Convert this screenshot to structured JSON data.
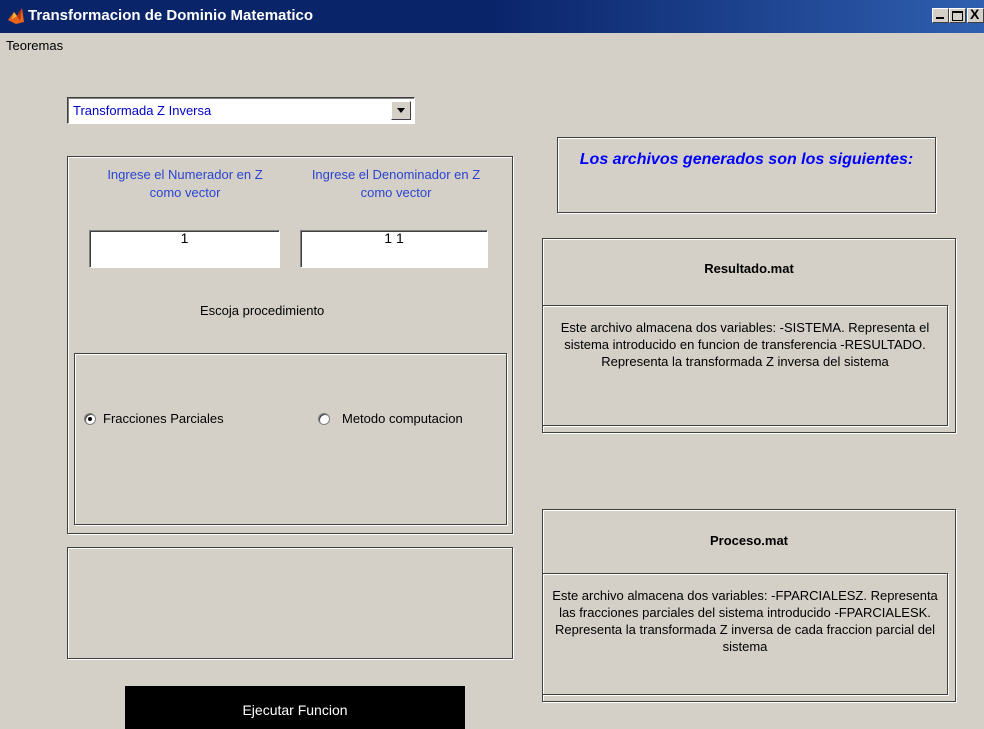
{
  "window": {
    "title": "Transformacion de Dominio Matematico",
    "close_glyph": "X"
  },
  "menu": {
    "items": [
      "Teoremas"
    ]
  },
  "transform_select": {
    "selected": "Transformada Z Inversa"
  },
  "inputs": {
    "numerator_label": "Ingrese el Numerador en Z como vector",
    "denominator_label": "Ingrese el Denominador en Z como vector",
    "numerator_value": "1",
    "denominator_value": "1 1"
  },
  "procedure": {
    "label": "Escoja procedimiento",
    "options": [
      "Fracciones Parciales",
      "Metodo computacion"
    ],
    "selected_index": 0
  },
  "actions": {
    "run_label": "Ejecutar Funcion"
  },
  "files": {
    "header": "Los archivos generados son los siguientes:",
    "resultado": {
      "title": "Resultado.mat",
      "description": "Este archivo almacena dos variables: -SISTEMA. Representa el sistema introducido en funcion de transferencia -RESULTADO. Representa la transformada Z inversa del sistema"
    },
    "proceso": {
      "title": "Proceso.mat",
      "description": "Este archivo almacena dos variables: -FPARCIALESZ. Representa las fracciones parciales del sistema introducido -FPARCIALESK. Representa la transformada Z inversa de cada fraccion parcial del sistema"
    }
  },
  "icons": {
    "app": "matlab-icon",
    "minimize": "minimize-icon",
    "maximize": "maximize-icon",
    "close": "close-icon",
    "dropdown": "chevron-down-icon"
  },
  "colors": {
    "titlebar": "#0a246a",
    "window_bg": "#d4d0c8",
    "label_blue": "#2a43d1",
    "header_blue": "#0000ff",
    "run_button_bg": "#000000"
  }
}
